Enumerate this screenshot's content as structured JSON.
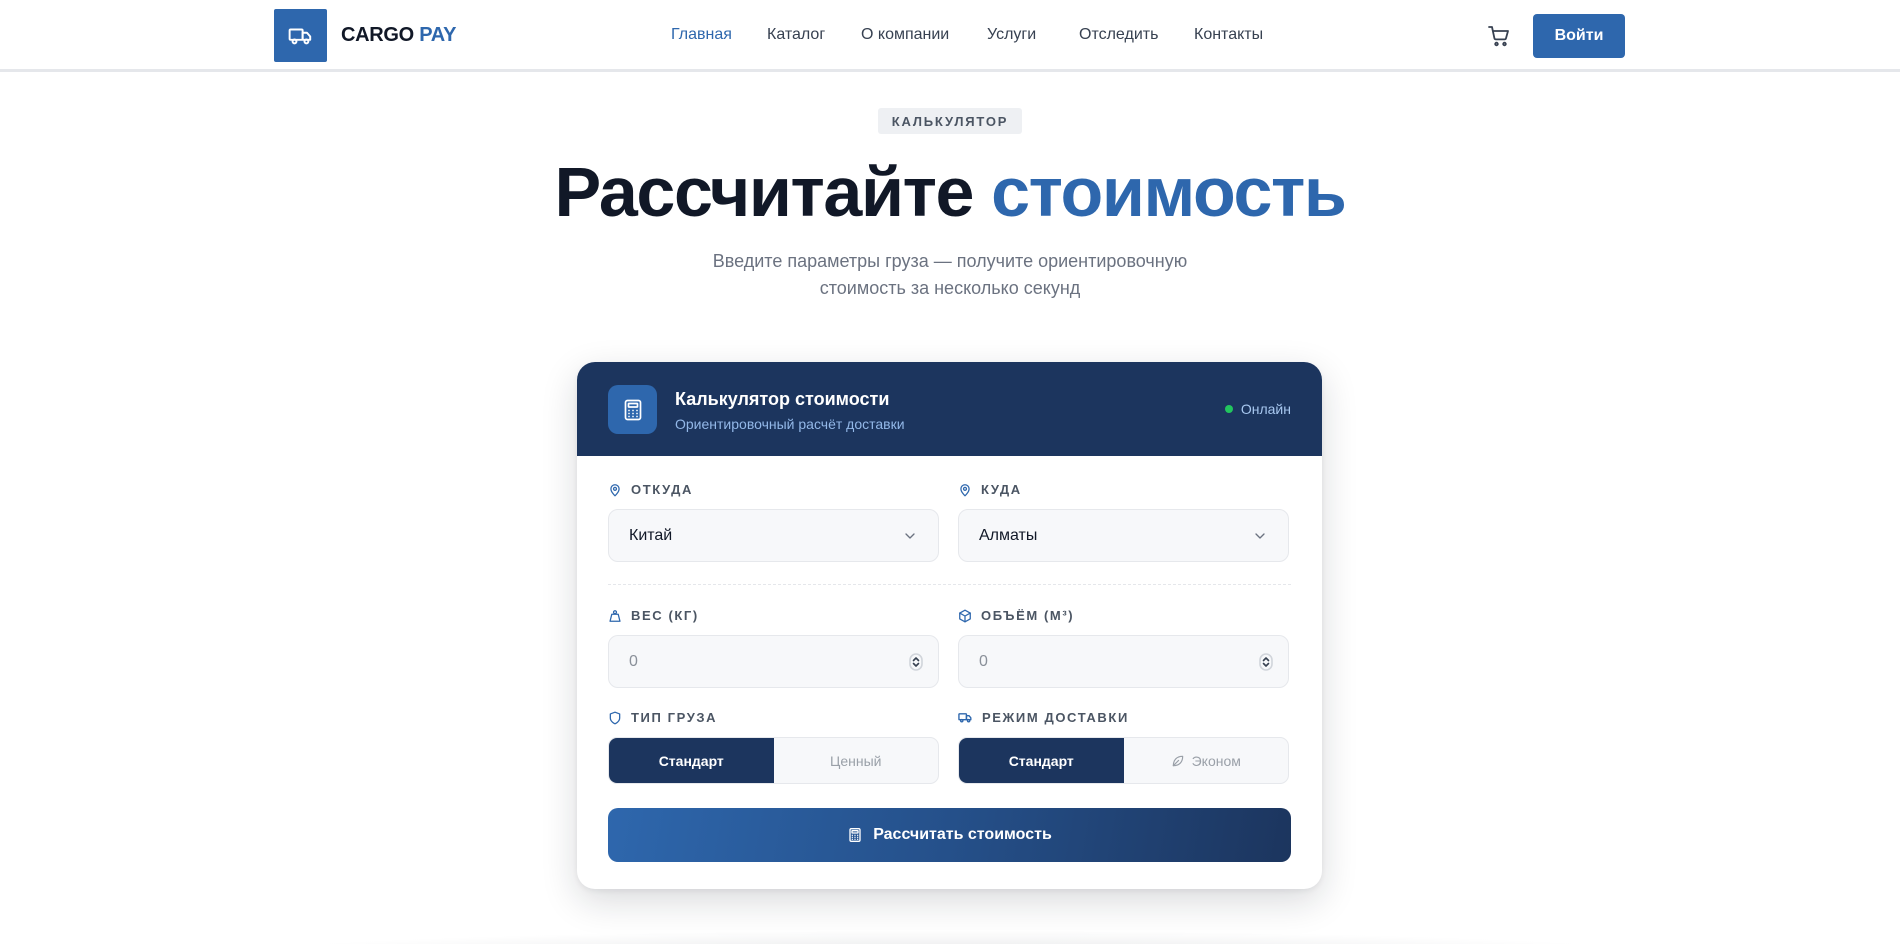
{
  "brand": {
    "name_main": "CARGO",
    "name_accent": "PAY",
    "primary_color": "#2e67ad",
    "dark_color": "#1c355e"
  },
  "nav": {
    "links": [
      {
        "label": "Главная",
        "active": true
      },
      {
        "label": "Каталог",
        "active": false
      },
      {
        "label": "О компании",
        "active": false
      },
      {
        "label": "Услуги",
        "active": false
      },
      {
        "label": "Отследить",
        "active": false
      },
      {
        "label": "Контакты",
        "active": false
      }
    ],
    "cart_icon": "cart-icon",
    "login_label": "Войти"
  },
  "hero": {
    "eyebrow": "КАЛЬКУЛЯТОР",
    "title_main": "Рассчитайте",
    "title_accent": "стоимость",
    "subtitle_line1": "Введите параметры груза — получите ориентировочную",
    "subtitle_line2": "стоимость за несколько секунд"
  },
  "calculator": {
    "title": "Калькулятор стоимости",
    "subtitle": "Ориентировочный расчёт доставки",
    "status": "Онлайн",
    "status_color": "#22c55e",
    "from": {
      "label": "ОТКУДА",
      "value": "Китай"
    },
    "to": {
      "label": "КУДА",
      "value": "Алматы"
    },
    "weight": {
      "label": "ВЕС (КГ)",
      "placeholder": "0"
    },
    "volume": {
      "label": "ОБЪЁМ (М³)",
      "placeholder": "0"
    },
    "cargo_type": {
      "label": "ТИП ГРУЗА",
      "options": [
        {
          "label": "Стандарт",
          "selected": true
        },
        {
          "label": "Ценный",
          "selected": false
        }
      ]
    },
    "delivery_mode": {
      "label": "РЕЖИМ ДОСТАВКИ",
      "options": [
        {
          "label": "Стандарт",
          "selected": true
        },
        {
          "label": "Эконом",
          "selected": false
        }
      ]
    },
    "submit_label": "Рассчитать стоимость"
  }
}
